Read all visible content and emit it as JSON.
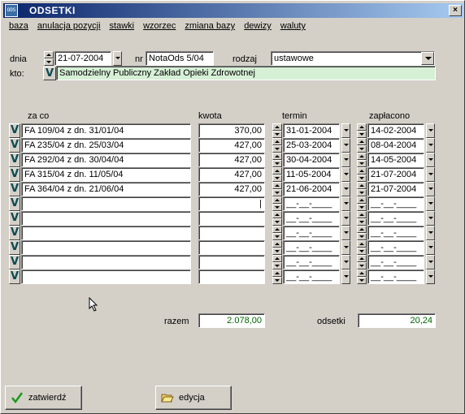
{
  "window": {
    "title": "ODSETKI",
    "icon_text": "ODS",
    "close_glyph": "×"
  },
  "menu": [
    "baza",
    "anulacja pozycji",
    "stawki",
    "wzorzec",
    "zmiana bazy",
    "dewizy",
    "waluty"
  ],
  "header": {
    "dnia_label": "dnia",
    "date_value": "21-07-2004",
    "nr_label": "nr",
    "nr_value": "NotaOds 5/04",
    "rodzaj_label": "rodzaj",
    "rodzaj_value": "ustawowe",
    "kto_label": "kto:",
    "kto_value": "Samodzielny Publiczny Zakład Opieki Zdrowotnej"
  },
  "table": {
    "headers": {
      "zaco": "za co",
      "kwota": "kwota",
      "termin": "termin",
      "zaplacono": "zapłacono"
    },
    "v_glyph": "V",
    "rows": [
      {
        "zaco": "FA  109/04 z dn. 31/01/04",
        "kwota": "370,00",
        "termin": "31-01-2004",
        "zaplacono": "14-02-2004"
      },
      {
        "zaco": "FA  235/04 z dn. 25/03/04",
        "kwota": "427,00",
        "termin": "25-03-2004",
        "zaplacono": "08-04-2004"
      },
      {
        "zaco": "FA  292/04 z dn. 30/04/04",
        "kwota": "427,00",
        "termin": "30-04-2004",
        "zaplacono": "14-05-2004"
      },
      {
        "zaco": "FA  315/04 z dn. 11/05/04",
        "kwota": "427,00",
        "termin": "11-05-2004",
        "zaplacono": "21-07-2004"
      },
      {
        "zaco": "FA  364/04 z dn. 21/06/04",
        "kwota": "427,00",
        "termin": "21-06-2004",
        "zaplacono": "21-07-2004"
      },
      {
        "zaco": "",
        "kwota": "|",
        "termin": "__-__-____",
        "zaplacono": "__-__-____"
      },
      {
        "zaco": "",
        "kwota": "",
        "termin": "__-__-____",
        "zaplacono": "__-__-____"
      },
      {
        "zaco": "",
        "kwota": "",
        "termin": "__-__-____",
        "zaplacono": "__-__-____"
      },
      {
        "zaco": "",
        "kwota": "",
        "termin": "__-__-____",
        "zaplacono": "__-__-____"
      },
      {
        "zaco": "",
        "kwota": "",
        "termin": "__-__-____",
        "zaplacono": "__-__-____"
      },
      {
        "zaco": "",
        "kwota": "",
        "termin": "__-__-____",
        "zaplacono": "__-__-____"
      }
    ]
  },
  "totals": {
    "razem_label": "razem",
    "razem_value": "2.078,00",
    "odsetki_label": "odsetki",
    "odsetki_value": "20,24"
  },
  "buttons": {
    "zatwierdz": "zatwierdź",
    "edycja": "edycja"
  },
  "colors": {
    "title_bar": "#0a246a",
    "value_green": "#006400",
    "kto_bg": "#d6f0d6"
  }
}
